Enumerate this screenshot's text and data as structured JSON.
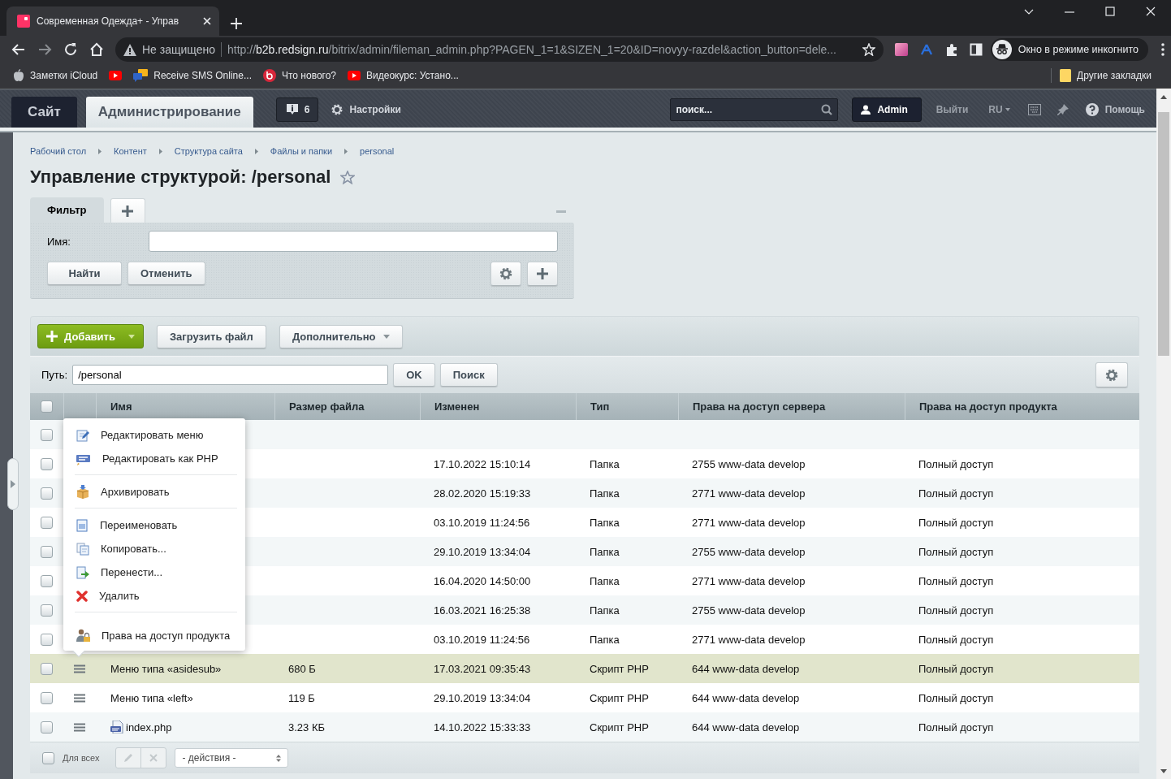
{
  "browser": {
    "tab_title": "Современная Одежда+ - Управ",
    "security": "Не защищено",
    "url_scheme": "http://",
    "url_host": "b2b.redsign.ru",
    "url_rest": "/bitrix/admin/fileman_admin.php?PAGEN_1=1&SIZEN_1=20&ID=novyy-razdel&action_button=dele...",
    "incognito": "Окно в режиме инкогнито",
    "bookmarks": [
      {
        "label": "Заметки iCloud",
        "kind": "apple"
      },
      {
        "kind": "youtube"
      },
      {
        "label": "Receive SMS Online...",
        "kind": "chat"
      },
      {
        "label": "Что нового?",
        "kind": "b24"
      },
      {
        "label": "Видеокурс: Устано...",
        "kind": "youtube"
      }
    ],
    "other_bookmarks": "Другие закладки"
  },
  "header": {
    "tabs": [
      {
        "label": "Сайт",
        "selected": false
      },
      {
        "label": "Администрирование",
        "selected": true
      }
    ],
    "notifications": "6",
    "settings": "Настройки",
    "search": {
      "placeholder": "поиск..."
    },
    "user": "Admin",
    "logout": "Выйти",
    "language": "RU",
    "help": "Помощь"
  },
  "breadcrumbs": [
    "Рабочий стол",
    "Контент",
    "Структура сайта",
    "Файлы и папки",
    "personal"
  ],
  "page_title": "Управление структурой: /personal",
  "filter": {
    "tabs": [
      {
        "label": "Фильтр",
        "selected": true
      }
    ],
    "field_label": "Имя:",
    "buttons": [
      "Найти",
      "Отменить"
    ]
  },
  "toolbar": {
    "add": "Добавить",
    "upload": "Загрузить файл",
    "more": "Дополнительно"
  },
  "path": {
    "label": "Путь:",
    "value": "/personal",
    "buttons": [
      "OK",
      "Поиск"
    ]
  },
  "table": {
    "select_all": {
      "checked": false
    },
    "columns": [
      "Имя",
      "Размер файла",
      "Изменен",
      "Тип",
      "Права на доступ сервера",
      "Права на доступ продукта"
    ],
    "rows": [
      {
        "checked": false,
        "highlighted": false
      },
      {
        "checked": false,
        "highlighted": false,
        "modified": "17.10.2022 15:10:14",
        "type": "Папка",
        "server_rights": "2755 www-data develop",
        "product_rights": "Полный доступ"
      },
      {
        "checked": false,
        "highlighted": false,
        "modified": "28.02.2020 15:19:33",
        "type": "Папка",
        "server_rights": "2771 www-data develop",
        "product_rights": "Полный доступ"
      },
      {
        "checked": false,
        "highlighted": false,
        "modified": "03.10.2019 11:24:56",
        "type": "Папка",
        "server_rights": "2771 www-data develop",
        "product_rights": "Полный доступ"
      },
      {
        "checked": false,
        "highlighted": false,
        "modified": "29.10.2019 13:34:04",
        "type": "Папка",
        "server_rights": "2755 www-data develop",
        "product_rights": "Полный доступ"
      },
      {
        "checked": false,
        "highlighted": false,
        "modified": "16.04.2020 14:50:00",
        "type": "Папка",
        "server_rights": "2771 www-data develop",
        "product_rights": "Полный доступ"
      },
      {
        "checked": false,
        "highlighted": false,
        "modified": "16.03.2021 16:25:38",
        "type": "Папка",
        "server_rights": "2755 www-data develop",
        "product_rights": "Полный доступ"
      },
      {
        "checked": false,
        "highlighted": false,
        "modified": "03.10.2019 11:24:56",
        "type": "Папка",
        "server_rights": "2771 www-data develop",
        "product_rights": "Полный доступ"
      },
      {
        "checked": false,
        "highlighted": true,
        "kind": "menu-file",
        "name": "Меню типа «asidesub»",
        "size": "680 Б",
        "modified": "17.03.2021 09:35:43",
        "type": "Скрипт PHP",
        "server_rights": "644 www-data develop",
        "product_rights": "Полный доступ"
      },
      {
        "checked": false,
        "highlighted": false,
        "kind": "menu-file",
        "name": "Меню типа «left»",
        "size": "119 Б",
        "modified": "29.10.2019 13:34:04",
        "type": "Скрипт PHP",
        "server_rights": "644 www-data develop",
        "product_rights": "Полный доступ"
      },
      {
        "checked": false,
        "highlighted": false,
        "kind": "php-file",
        "name": "index.php",
        "size": "3.23 КБ",
        "modified": "14.10.2022 15:33:33",
        "type": "Скрипт PHP",
        "server_rights": "644 www-data develop",
        "product_rights": "Полный доступ"
      }
    ]
  },
  "footer": {
    "checked": false,
    "for_all": "Для всех",
    "actions": "- действия -"
  },
  "context_menu": {
    "groups": [
      {
        "items": [
          {
            "kind": "edit-menu",
            "label": "Редактировать меню"
          },
          {
            "kind": "edit-php",
            "label": "Редактировать как PHP"
          }
        ]
      },
      {
        "items": [
          {
            "kind": "archive",
            "label": "Архивировать"
          }
        ]
      },
      {
        "items": [
          {
            "kind": "rename",
            "label": "Переименовать"
          },
          {
            "kind": "copy",
            "label": "Копировать..."
          },
          {
            "kind": "move",
            "label": "Перенести..."
          },
          {
            "kind": "delete",
            "label": "Удалить"
          }
        ]
      },
      {
        "items": [
          {
            "kind": "access",
            "label": "Права на доступ продукта"
          }
        ]
      }
    ]
  }
}
